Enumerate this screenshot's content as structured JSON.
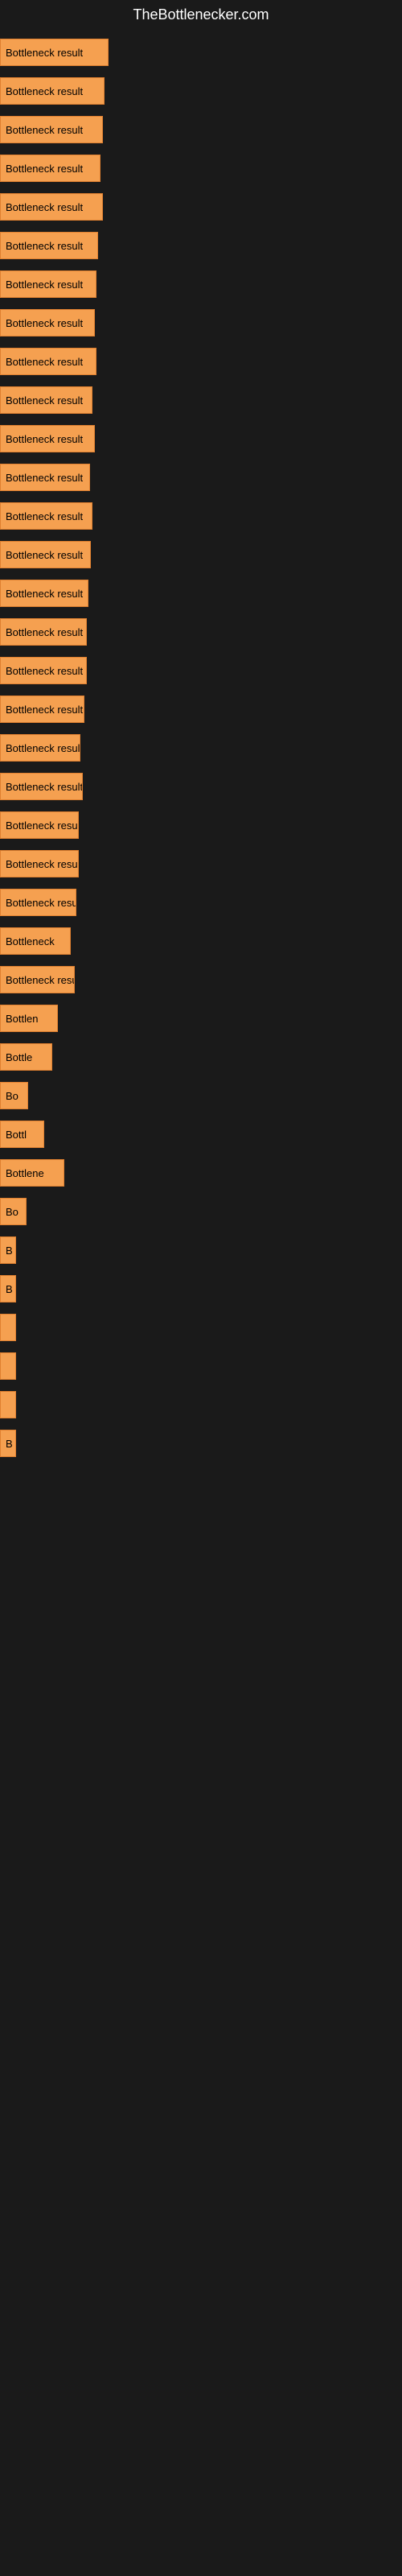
{
  "site": {
    "title": "TheBottlenecker.com"
  },
  "bars": [
    {
      "label": "Bottleneck result",
      "width": 135
    },
    {
      "label": "Bottleneck result",
      "width": 130
    },
    {
      "label": "Bottleneck result",
      "width": 128
    },
    {
      "label": "Bottleneck result",
      "width": 125
    },
    {
      "label": "Bottleneck result",
      "width": 128
    },
    {
      "label": "Bottleneck result",
      "width": 122
    },
    {
      "label": "Bottleneck result",
      "width": 120
    },
    {
      "label": "Bottleneck result",
      "width": 118
    },
    {
      "label": "Bottleneck result",
      "width": 120
    },
    {
      "label": "Bottleneck result",
      "width": 115
    },
    {
      "label": "Bottleneck result",
      "width": 118
    },
    {
      "label": "Bottleneck result",
      "width": 112
    },
    {
      "label": "Bottleneck result",
      "width": 115
    },
    {
      "label": "Bottleneck result",
      "width": 113
    },
    {
      "label": "Bottleneck result",
      "width": 110
    },
    {
      "label": "Bottleneck result",
      "width": 108
    },
    {
      "label": "Bottleneck result",
      "width": 108
    },
    {
      "label": "Bottleneck result",
      "width": 105
    },
    {
      "label": "Bottleneck result",
      "width": 100
    },
    {
      "label": "Bottleneck result",
      "width": 103
    },
    {
      "label": "Bottleneck result",
      "width": 98
    },
    {
      "label": "Bottleneck result",
      "width": 98
    },
    {
      "label": "Bottleneck result",
      "width": 95
    },
    {
      "label": "Bottleneck",
      "width": 88
    },
    {
      "label": "Bottleneck result",
      "width": 93
    },
    {
      "label": "Bottlen",
      "width": 72
    },
    {
      "label": "Bottle",
      "width": 65
    },
    {
      "label": "Bo",
      "width": 35
    },
    {
      "label": "Bottl",
      "width": 55
    },
    {
      "label": "Bottlene",
      "width": 80
    },
    {
      "label": "Bo",
      "width": 33
    },
    {
      "label": "B",
      "width": 16
    },
    {
      "label": "B",
      "width": 20
    },
    {
      "label": "",
      "width": 8
    },
    {
      "label": "",
      "width": 6
    },
    {
      "label": "",
      "width": 5
    },
    {
      "label": "B",
      "width": 18
    }
  ]
}
